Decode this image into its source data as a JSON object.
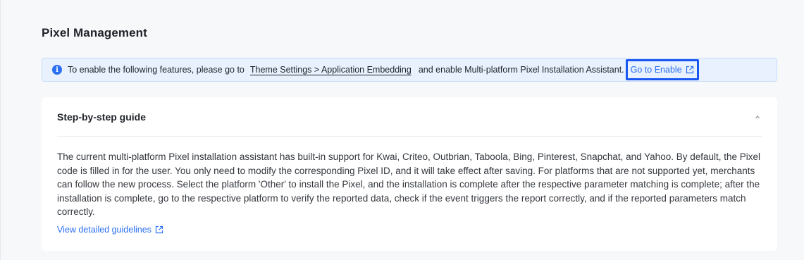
{
  "page": {
    "title": "Pixel Management"
  },
  "banner": {
    "icon": "info-icon",
    "icon_glyph": "i",
    "text_before": "To enable the following features, please go to",
    "settings_link": "Theme Settings > Application Embedding",
    "text_after": "and enable Multi-platform Pixel Installation Assistant.",
    "action_label": "Go to Enable",
    "action_icon": "external-link-icon",
    "accent_color": "#2b6ff2",
    "background_color": "#e8f1fd"
  },
  "guide": {
    "title": "Step-by-step guide",
    "collapse_icon": "chevron-up-icon",
    "body": "The current multi-platform Pixel installation assistant has built-in support for Kwai, Criteo, Outbrian, Taboola, Bing, Pinterest, Snapchat, and Yahoo. By default, the Pixel code is filled in for the user. You only need to modify the corresponding Pixel ID, and it will take effect after saving. For platforms that are not supported yet, merchants can follow the new process. Select the platform 'Other' to install the Pixel, and the installation is complete after the respective parameter matching is complete; after the installation is complete, go to the respective platform to verify the reported data, check if the event triggers the report correctly, and if the reported parameters match correctly.",
    "link_label": "View detailed guidelines",
    "link_icon": "external-link-icon"
  }
}
